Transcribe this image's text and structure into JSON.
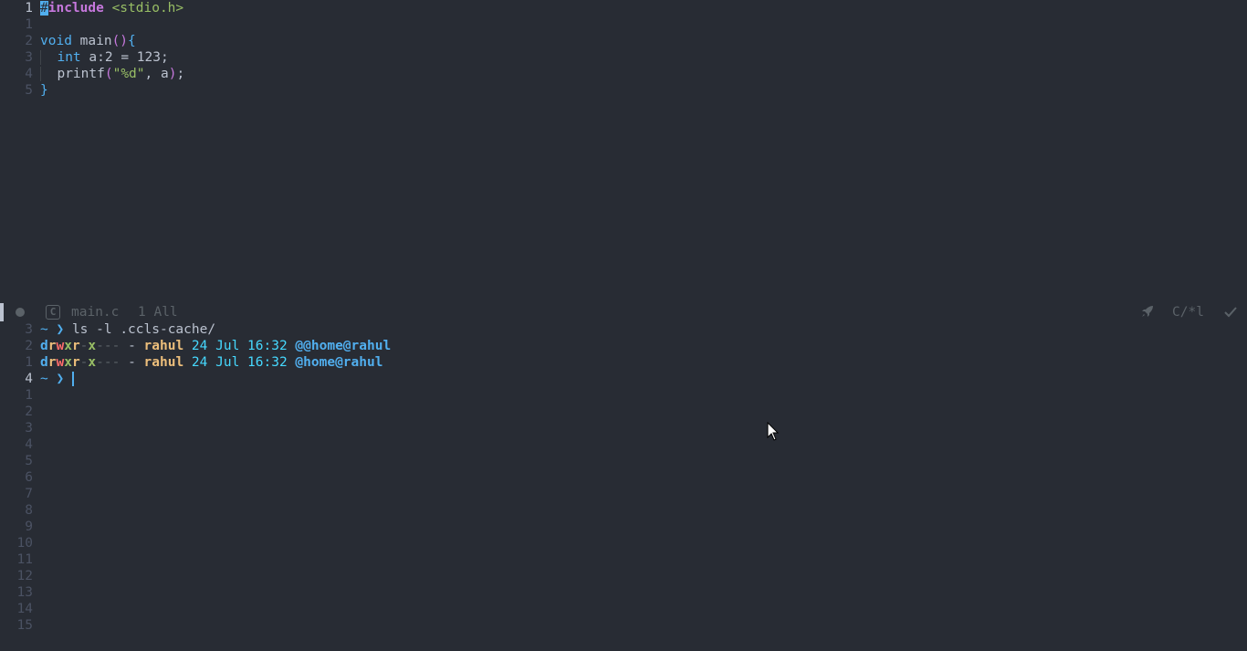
{
  "editor": {
    "lines": [
      {
        "num": "1",
        "current": true,
        "parts": [
          [
            "#",
            "cursor-block"
          ],
          [
            "include",
            "inc"
          ],
          [
            " ",
            ""
          ],
          [
            "<stdio.h>",
            "hdr"
          ]
        ]
      },
      {
        "num": "1",
        "current": false,
        "parts": []
      },
      {
        "num": "2",
        "current": false,
        "parts": [
          [
            "void",
            "kw"
          ],
          [
            " main",
            "ident"
          ],
          [
            "()",
            "paren"
          ],
          [
            "{",
            "brace"
          ]
        ]
      },
      {
        "num": "3",
        "current": false,
        "parts": [
          [
            "  ",
            "indent-guide"
          ],
          [
            "int",
            "kw"
          ],
          [
            " a:2 = ",
            "ident"
          ],
          [
            "123",
            "ident"
          ],
          [
            ";",
            "ident"
          ]
        ]
      },
      {
        "num": "4",
        "current": false,
        "parts": [
          [
            "  ",
            "indent-guide"
          ],
          [
            "printf",
            "ident"
          ],
          [
            "(",
            "paren"
          ],
          [
            "\"%d\"",
            "str"
          ],
          [
            ", a",
            "ident"
          ],
          [
            ")",
            "paren"
          ],
          [
            ";",
            "ident"
          ]
        ]
      },
      {
        "num": "5",
        "current": false,
        "parts": [
          [
            "}",
            "brace"
          ]
        ]
      }
    ]
  },
  "modeline": {
    "file_icon": "C",
    "file_name": "main.c",
    "position": "1 All",
    "mode": "C/*l",
    "rocket_icon": "rocket-icon",
    "check_icon": "check-icon"
  },
  "terminal": {
    "lines": [
      {
        "num": "3",
        "current": false,
        "parts": [
          [
            "~ ",
            "t-tilde"
          ],
          [
            "❯ ",
            "t-prompt"
          ],
          [
            "ls -l .ccls-cache/",
            "ident"
          ]
        ]
      },
      {
        "num": "2",
        "current": false,
        "parts": [
          [
            "d",
            "p-d"
          ],
          [
            "r",
            "p-r"
          ],
          [
            "w",
            "p-w"
          ],
          [
            "x",
            "p-x"
          ],
          [
            "r",
            "p-r"
          ],
          [
            "-",
            "p-dim"
          ],
          [
            "x",
            "p-x"
          ],
          [
            "---",
            "p-dim"
          ],
          [
            " - ",
            "ident"
          ],
          [
            "rahul",
            "t-user"
          ],
          [
            " 24 Jul 16:32 ",
            "t-date"
          ],
          [
            "@@home@rahul",
            "t-name"
          ]
        ]
      },
      {
        "num": "1",
        "current": false,
        "parts": [
          [
            "d",
            "p-d"
          ],
          [
            "r",
            "p-r"
          ],
          [
            "w",
            "p-w"
          ],
          [
            "x",
            "p-x"
          ],
          [
            "r",
            "p-r"
          ],
          [
            "-",
            "p-dim"
          ],
          [
            "x",
            "p-x"
          ],
          [
            "---",
            "p-dim"
          ],
          [
            " - ",
            "ident"
          ],
          [
            "rahul",
            "t-user"
          ],
          [
            " 24 Jul 16:32 ",
            "t-date"
          ],
          [
            "@home@rahul",
            "t-name"
          ]
        ]
      },
      {
        "num": "4",
        "current": true,
        "parts": [
          [
            "~ ",
            "t-tilde"
          ],
          [
            "❯ ",
            "t-prompt"
          ]
        ],
        "cursor": true
      },
      {
        "num": "1",
        "current": false,
        "parts": []
      },
      {
        "num": "2",
        "current": false,
        "parts": []
      },
      {
        "num": "3",
        "current": false,
        "parts": []
      },
      {
        "num": "4",
        "current": false,
        "parts": []
      },
      {
        "num": "5",
        "current": false,
        "parts": []
      },
      {
        "num": "6",
        "current": false,
        "parts": []
      },
      {
        "num": "7",
        "current": false,
        "parts": []
      },
      {
        "num": "8",
        "current": false,
        "parts": []
      },
      {
        "num": "9",
        "current": false,
        "parts": []
      },
      {
        "num": "10",
        "current": false,
        "parts": []
      },
      {
        "num": "11",
        "current": false,
        "parts": []
      },
      {
        "num": "12",
        "current": false,
        "parts": []
      },
      {
        "num": "13",
        "current": false,
        "parts": []
      },
      {
        "num": "14",
        "current": false,
        "parts": []
      },
      {
        "num": "15",
        "current": false,
        "parts": []
      }
    ]
  }
}
